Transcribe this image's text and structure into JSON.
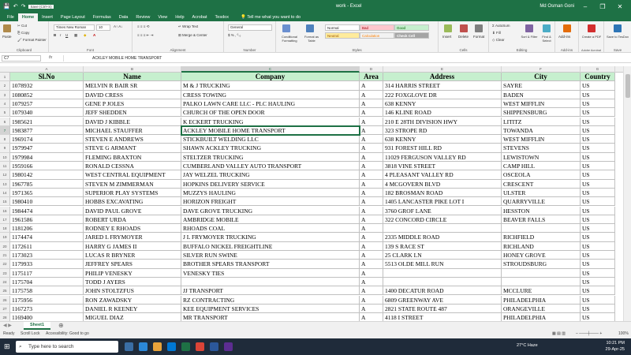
{
  "window": {
    "title": "work - Excel",
    "user": "Md Osman Goni",
    "autosave_tooltip": "Save (Ctrl+S)"
  },
  "ribbon_tabs": [
    "File",
    "Home",
    "Insert",
    "Page Layout",
    "Formulas",
    "Data",
    "Review",
    "View",
    "Help",
    "Acrobat",
    "Tesdox"
  ],
  "tell_me": "Tell me what you want to do",
  "ribbon": {
    "clipboard": {
      "label": "Clipboard",
      "paste": "Paste",
      "cut": "Cut",
      "copy": "Copy",
      "format_painter": "Format Painter"
    },
    "font": {
      "label": "Font",
      "font_name": "Times New Roman",
      "font_size": "10"
    },
    "alignment": {
      "label": "Alignment",
      "wrap_text": "Wrap Text",
      "merge_center": "Merge & Center"
    },
    "number": {
      "label": "Number",
      "format": "General"
    },
    "styles": {
      "label": "Styles",
      "conditional": "Conditional Formatting",
      "format_as_table": "Format as Table",
      "normal": "Normal",
      "bad": "Bad",
      "good": "Good",
      "neutral": "Neutral",
      "calculation": "Calculation",
      "check_cell": "Check Cell"
    },
    "cells": {
      "label": "Cells",
      "insert": "Insert",
      "delete": "Delete",
      "format": "Format"
    },
    "editing": {
      "label": "Editing",
      "autosum": "AutoSum",
      "fill": "Fill",
      "clear": "Clear",
      "sort_filter": "Sort & Filter",
      "find_select": "Find & Select"
    },
    "addins": {
      "label": "Add-ins",
      "addins": "Add-ins"
    },
    "acrobat": {
      "label": "Adobe Acrobat",
      "create_pdf": "Create a PDF"
    },
    "tesdox": {
      "label": "Save",
      "save_to": "Save to TesDox"
    }
  },
  "formula_bar": {
    "name_box": "C7",
    "fx": "fx",
    "value": "ACKLEY MOBILE HOME TRANSPORT"
  },
  "columns": [
    "A",
    "B",
    "C",
    "D",
    "E",
    "F",
    "G"
  ],
  "headers": [
    "Sl.No",
    "Name",
    "Company",
    "Area",
    "Address",
    "City",
    "Country"
  ],
  "rows": [
    [
      "1078932",
      "MELVIN R BAIR SR",
      "M & J TRUCKING",
      "A",
      "314 HARRIS STREET",
      "SAYRE",
      "US"
    ],
    [
      "1080852",
      "DAVID CRESS",
      "CRESS TOWING",
      "A",
      "222 FOXGLOVE DR",
      "BADEN",
      "US"
    ],
    [
      "1079257",
      "GENE P JOLES",
      "PALKO LAWN CARE LLC - PLC HAULING",
      "A",
      "638 KENNY",
      "WEST MIFFLIN",
      "US"
    ],
    [
      "1079340",
      "JEFF SHEDDEN",
      "CHURCH OF THE OPEN DOOR",
      "A",
      "146 KLINE ROAD",
      "SHIPPENSBURG",
      "US"
    ],
    [
      "1985621",
      "DAVID J KIBBLE",
      "K ECKERT TRUCKING",
      "A",
      "210 E 28TH DIVISION HWY",
      "LITITZ",
      "US"
    ],
    [
      "1983877",
      "MICHAEL STAUFFER",
      "ACKLEY MOBILE HOME TRANSPORT",
      "A",
      "323 STROPE RD",
      "TOWANDA",
      "US"
    ],
    [
      "1969174",
      "STEVEN E ANDREWS",
      "STICKBUILT WELDING LLC",
      "A",
      "638 KENNY",
      "WEST MIFFLIN",
      "US"
    ],
    [
      "1979947",
      "STEVE G ARMANT",
      "SHAWN ACKLEY TRUCKING",
      "A",
      "931 FOREST HILL RD",
      "STEVENS",
      "US"
    ],
    [
      "1979984",
      "FLEMING BRAXTON",
      "STELTZER TRUCKING",
      "A",
      "11029 FERGUSON VALLEY RD",
      "LEWISTOWN",
      "US"
    ],
    [
      "1959166",
      "RONALD CESSNA",
      "CUMBERLAND VALLEY AUTO TRANSPORT",
      "A",
      "3818 VINE STREET",
      "CAMP HILL",
      "US"
    ],
    [
      "1980142",
      "WEST CENTRAL EQUIPMENT",
      "JAY WELZEL TRUCKING",
      "A",
      "4 PLEASANT VALLEY RD",
      "OSCEOLA",
      "US"
    ],
    [
      "1967785",
      "STEVEN M ZIMMERMAN",
      "HOPKINS DELIVERY SERVICE",
      "A",
      "4 MCGOVERN BLVD",
      "CRESCENT",
      "US"
    ],
    [
      "1971365",
      "SUPERIOR PLAY SYSTEMS",
      "MUZZYS HAULING",
      "A",
      "182 BROSMAN ROAD",
      "ULSTER",
      "US"
    ],
    [
      "1980410",
      "HOBBS EXCAVATING",
      "HORIZON FREIGHT",
      "A",
      "1405 LANCASTER PIKE LOT I",
      "QUARRYVILLE",
      "US"
    ],
    [
      "1984474",
      "DAVID PAUL GROVE",
      "DAVE GROVE TRUCKING",
      "A",
      "3760 GROF LANE",
      "HESSTON",
      "US"
    ],
    [
      "1961586",
      "ROBERT URDA",
      "AMBRIDGE MOBILE",
      "A",
      "322 CONCORD CIRCLE",
      "BEAVER FALLS",
      "US"
    ],
    [
      "1181206",
      "RODNEY E RHOADS",
      "RHOADS COAL",
      "A",
      "",
      "",
      "US"
    ],
    [
      "1174474",
      "JARED L FRYMOYER",
      "J L FRYMOYER TRUCKING",
      "A",
      "2335 MIDDLE ROAD",
      "RICHFIELD",
      "US"
    ],
    [
      "1172611",
      "HARRY G JAMES II",
      "BUFFALO NICKEL FREIGHTLINE",
      "A",
      "139 S RACE ST",
      "RICHLAND",
      "US"
    ],
    [
      "1173023",
      "LUCAS R BRYNER",
      "SILVER RUN SWINE",
      "A",
      "25 CLARK LN",
      "HONEY GROVE",
      "US"
    ],
    [
      "1179933",
      "JEFFREY SPEARS",
      "BROTHER SPEARS TRANSPORT",
      "A",
      "5513 OLDE MILL RUN",
      "STROUDSBURG",
      "US"
    ],
    [
      "1175117",
      "PHILIP VENESKY",
      "VENESKY TIES",
      "A",
      "",
      "",
      "US"
    ],
    [
      "1175704",
      "TODD J AYERS",
      "",
      "A",
      "",
      "",
      "US"
    ],
    [
      "1175758",
      "JOHN STOLTZFUS",
      "JJ TRANSPORT",
      "A",
      "1400 DECATUR ROAD",
      "MCCLURE",
      "US"
    ],
    [
      "1175956",
      "RON ZAWADSKY",
      "RZ CONTRACTING",
      "A",
      "6809 GREENWAY AVE",
      "PHILADELPHIA",
      "US"
    ],
    [
      "1167273",
      "DANIEL R KEENEY",
      "KEE EQUIPMENT SERVICES",
      "A",
      "2821 STATE ROUTE 487",
      "ORANGEVILLE",
      "US"
    ],
    [
      "1169400",
      "MIGUEL DIAZ",
      "MR TRANSPORT",
      "A",
      "4118 I STREET",
      "PHILADELPHIA",
      "US"
    ]
  ],
  "sheet_tab": "Sheet1",
  "status": {
    "ready": "Ready",
    "scroll_lock": "Scroll Lock",
    "accessibility": "Accessibility: Good to go",
    "zoom": "100%"
  },
  "taskbar": {
    "search_placeholder": "Type here to search",
    "weather": "27°C Haze",
    "time": "10:21 PM",
    "date": "29-Apr-25"
  },
  "colors": {
    "excel_green": "#1e7145",
    "header_fill": "#c6efce",
    "taskbar": "#1f2b3a"
  }
}
